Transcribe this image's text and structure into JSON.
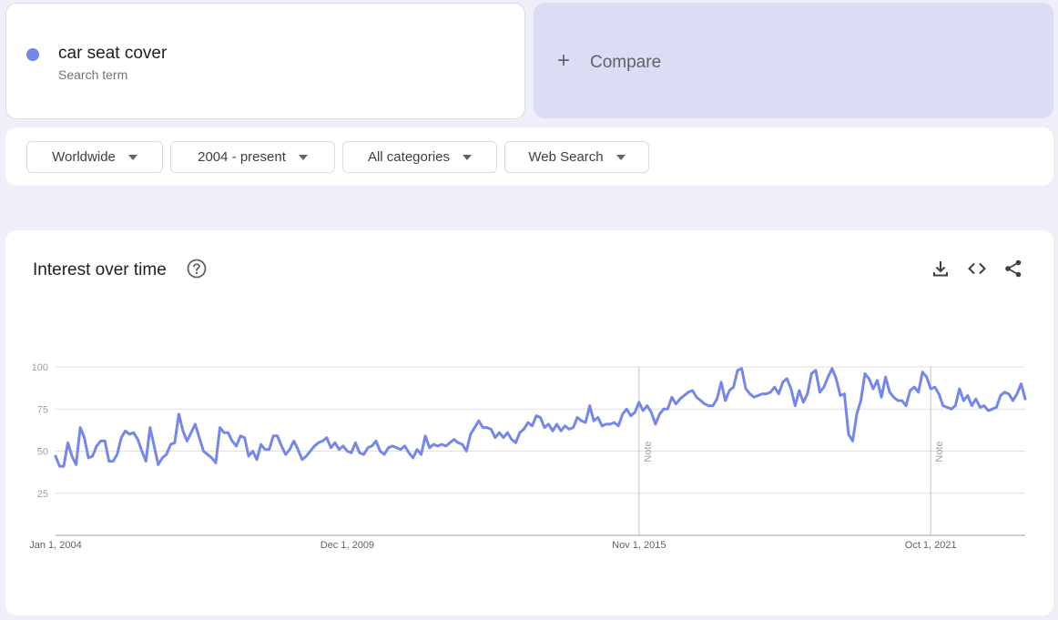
{
  "search_term": {
    "name": "car seat cover",
    "subtitle": "Search term",
    "color": "#7587ea"
  },
  "compare": {
    "label": "Compare",
    "background": "#dcdcf4"
  },
  "filters": [
    {
      "label": "Worldwide"
    },
    {
      "label": "2004 - present"
    },
    {
      "label": "All categories"
    },
    {
      "label": "Web Search"
    }
  ],
  "chart_panel": {
    "title": "Interest over time",
    "icons": [
      "help-icon",
      "download-icon",
      "embed-code-icon",
      "share-icon"
    ]
  },
  "chart_data": {
    "type": "line",
    "title": "Interest over time",
    "xlabel": "",
    "ylabel": "",
    "ylim": [
      0,
      100
    ],
    "yticks": [
      25,
      50,
      75,
      100
    ],
    "x_tick_labels": [
      "Jan 1, 2004",
      "Dec 1, 2009",
      "Nov 1, 2015",
      "Oct 1, 2021"
    ],
    "x_tick_month_index": [
      0,
      71,
      142,
      213
    ],
    "notes": [
      {
        "label": "Note",
        "month_index": 142
      },
      {
        "label": "Note",
        "month_index": 213
      }
    ],
    "grid": true,
    "series": [
      {
        "color": "#7587ea",
        "start": "2004-01",
        "frequency": "monthly",
        "values": [
          47,
          41,
          41,
          55,
          47,
          42,
          64,
          58,
          46,
          47,
          53,
          56,
          56,
          44,
          44,
          48,
          58,
          62,
          60,
          61,
          57,
          50,
          44,
          64,
          53,
          42,
          46,
          48,
          54,
          55,
          72,
          62,
          56,
          61,
          66,
          58,
          50,
          48,
          46,
          43,
          64,
          61,
          61,
          56,
          53,
          59,
          58,
          47,
          50,
          45,
          54,
          51,
          51,
          59,
          59,
          53,
          48,
          51,
          56,
          51,
          45,
          47,
          50,
          53,
          55,
          56,
          58,
          52,
          55,
          51,
          53,
          50,
          49,
          55,
          49,
          48,
          52,
          53,
          56,
          50,
          48,
          52,
          53,
          52,
          51,
          53,
          49,
          46,
          51,
          48,
          59,
          52,
          54,
          53,
          54,
          53,
          55,
          57,
          55,
          54,
          50,
          60,
          64,
          68,
          64,
          64,
          63,
          58,
          61,
          58,
          61,
          57,
          55,
          61,
          63,
          67,
          65,
          71,
          70,
          64,
          66,
          62,
          66,
          62,
          65,
          63,
          64,
          70,
          68,
          67,
          77,
          68,
          70,
          65,
          66,
          66,
          67,
          65,
          72,
          75,
          71,
          73,
          79,
          74,
          77,
          73,
          66,
          72,
          75,
          75,
          82,
          78,
          81,
          83,
          85,
          86,
          82,
          80,
          78,
          77,
          77,
          81,
          91,
          80,
          86,
          88,
          98,
          99,
          87,
          84,
          82,
          83,
          84,
          84,
          85,
          88,
          84,
          91,
          93,
          87,
          77,
          86,
          79,
          84,
          96,
          98,
          85,
          88,
          94,
          99,
          93,
          83,
          84,
          60,
          56,
          72,
          80,
          96,
          93,
          87,
          92,
          82,
          94,
          85,
          82,
          80,
          80,
          77,
          86,
          88,
          85,
          97,
          94,
          87,
          88,
          84,
          77,
          76,
          75,
          77,
          87,
          80,
          83,
          77,
          81,
          76,
          77,
          74,
          75,
          76,
          83,
          85,
          84,
          80,
          84,
          90,
          81
        ]
      }
    ]
  }
}
